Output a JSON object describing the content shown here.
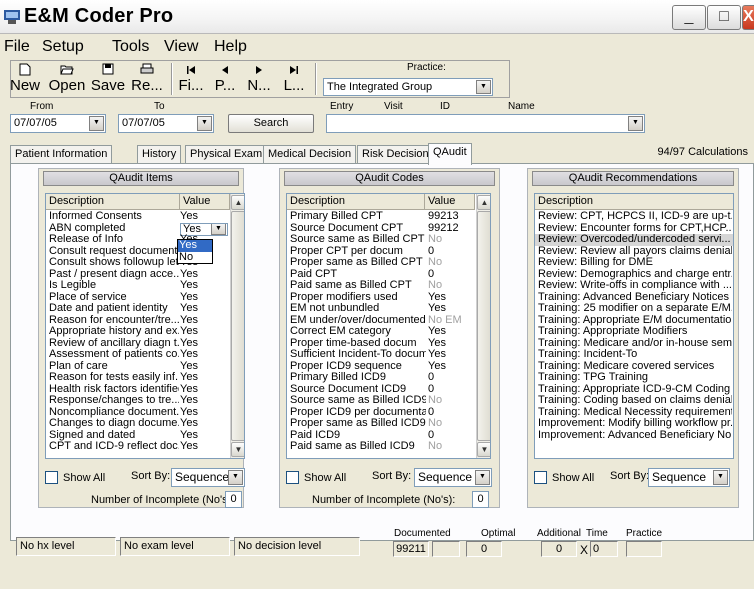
{
  "window": {
    "title": "E&M Coder Pro",
    "minimize_glyph": "_",
    "maximize_glyph": "□",
    "close_glyph": "X"
  },
  "menu": [
    "File",
    "Setup",
    "Tools",
    "View",
    "Help"
  ],
  "toolbar": {
    "buttons": [
      {
        "label": "New",
        "icon": "new-file-icon",
        "glyph": "🗋"
      },
      {
        "label": "Open",
        "icon": "open-folder-icon",
        "glyph": "📂"
      },
      {
        "label": "Save",
        "icon": "save-disk-icon",
        "glyph": "💾"
      },
      {
        "label": "Re...",
        "icon": "printer-icon",
        "glyph": "🖶"
      },
      {
        "label": "Fi...",
        "icon": "first-record-icon",
        "glyph": "|◂"
      },
      {
        "label": "P...",
        "icon": "previous-record-icon",
        "glyph": "◂"
      },
      {
        "label": "N...",
        "icon": "next-record-icon",
        "glyph": "▸"
      },
      {
        "label": "L...",
        "icon": "last-record-icon",
        "glyph": "▸|"
      }
    ],
    "practice_label": "Practice:",
    "practice_value": "The Integrated Group"
  },
  "filter": {
    "from_label": "From",
    "to_label": "To",
    "from_value": "07/07/05",
    "to_value": "07/07/05",
    "search_label": "Search",
    "entry_label": "Entry",
    "visit_label": "Visit",
    "id_label": "ID",
    "name_label": "Name",
    "entry_value": ""
  },
  "tabs": [
    "Patient Information",
    "History",
    "Physical Exam",
    "Medical Decision",
    "Risk Decision",
    "QAudit"
  ],
  "active_tab": "QAudit",
  "calculations_text": "94/97 Calculations",
  "qaudit_items": {
    "header": "QAudit Items",
    "col_description": "Description",
    "col_value": "Value",
    "rows": [
      {
        "d": "Informed Consents",
        "v": "Yes"
      },
      {
        "d": "ABN completed",
        "v": "Yes"
      },
      {
        "d": "Release of Info",
        "v": "Yes"
      },
      {
        "d": "Consult request document...",
        "v": "No"
      },
      {
        "d": "Consult shows followup let...",
        "v": "Yes"
      },
      {
        "d": "Past / present diagn acce...",
        "v": "Yes"
      },
      {
        "d": "Is Legible",
        "v": "Yes"
      },
      {
        "d": "Place of service",
        "v": "Yes"
      },
      {
        "d": "Date and patient identity",
        "v": "Yes"
      },
      {
        "d": "Reason for encounter/tre...",
        "v": "Yes"
      },
      {
        "d": "Appropriate history and ex...",
        "v": "Yes"
      },
      {
        "d": "Review of ancillary diagn t...",
        "v": "Yes"
      },
      {
        "d": "Assessment of patients co...",
        "v": "Yes"
      },
      {
        "d": "Plan of care",
        "v": "Yes"
      },
      {
        "d": "Reason for tests easily inf...",
        "v": "Yes"
      },
      {
        "d": "Health risk factors identified",
        "v": "Yes"
      },
      {
        "d": "Response/changes to tre...",
        "v": "Yes"
      },
      {
        "d": "Noncompliance document...",
        "v": "Yes"
      },
      {
        "d": "Changes to diagn docume...",
        "v": "Yes"
      },
      {
        "d": "Signed and dated",
        "v": "Yes"
      },
      {
        "d": "CPT and ICD-9 reflect doc...",
        "v": "Yes"
      }
    ],
    "dropdown_options": [
      "Yes",
      "No"
    ],
    "dropdown_selected": "Yes",
    "show_all_label": "Show All",
    "sort_by_label": "Sort By:",
    "sort_value": "Sequence",
    "incomplete_label": "Number of Incomplete (No's):",
    "incomplete_value": "0"
  },
  "qaudit_codes": {
    "header": "QAudit Codes",
    "col_description": "Description",
    "col_value": "Value",
    "rows": [
      {
        "d": "Primary Billed CPT",
        "v": "99213",
        "grey": false
      },
      {
        "d": "Source Document CPT",
        "v": "99212",
        "grey": false
      },
      {
        "d": "Source same as Billed CPT",
        "v": "No",
        "grey": true
      },
      {
        "d": "Proper CPT per docum",
        "v": "0",
        "grey": false
      },
      {
        "d": "Proper same as Billed CPT",
        "v": "No",
        "grey": true
      },
      {
        "d": "Paid CPT",
        "v": "0",
        "grey": false
      },
      {
        "d": "Paid same as Billed CPT",
        "v": "No",
        "grey": true
      },
      {
        "d": "Proper modifiers used",
        "v": "Yes",
        "grey": false
      },
      {
        "d": "EM not unbundled",
        "v": "Yes",
        "grey": false
      },
      {
        "d": "EM under/over/documented",
        "v": "No EM",
        "grey": true
      },
      {
        "d": "Correct EM category",
        "v": "Yes",
        "grey": false
      },
      {
        "d": "Proper time-based docum",
        "v": "Yes",
        "grey": false
      },
      {
        "d": "Sufficient Incident-To docum",
        "v": "Yes",
        "grey": false
      },
      {
        "d": "Proper ICD9 sequence",
        "v": "Yes",
        "grey": false
      },
      {
        "d": "Primary Billed ICD9",
        "v": "0",
        "grey": false
      },
      {
        "d": "Source Document ICD9",
        "v": "0",
        "grey": false
      },
      {
        "d": "Source same as Billed ICD9",
        "v": "No",
        "grey": true
      },
      {
        "d": "Proper ICD9 per documenta...",
        "v": "0",
        "grey": false
      },
      {
        "d": "Proper same as Billed ICD9",
        "v": "No",
        "grey": true
      },
      {
        "d": "Paid ICD9",
        "v": "0",
        "grey": false
      },
      {
        "d": "Paid same as Billed ICD9",
        "v": "No",
        "grey": true
      }
    ],
    "show_all_label": "Show All",
    "sort_by_label": "Sort By:",
    "sort_value": "Sequence",
    "incomplete_label": "Number of Incomplete (No's):",
    "incomplete_value": "0"
  },
  "qaudit_recs": {
    "header": "QAudit Recommendations",
    "col_description": "Description",
    "rows": [
      "Review: CPT, HCPCS II, ICD-9 are up-t...",
      "Review: Encounter forms for CPT,HCP...",
      "Review: Overcoded/undercoded servi...",
      "Review: Review all payors claims denials",
      "Review: Billing for DME",
      "Review: Demographics and charge entr...",
      "Review: Write-offs in compliance with ...",
      "Training: Advanced Beneficiary Notices",
      "Training: 25 modifier on a separate E/M...",
      "Training: Appropriate E/M documentation",
      "Training: Appropriate Modifiers",
      "Training: Medicare and/or in-house sem...",
      "Training: Incident-To",
      "Training: Medicare covered services",
      "Training: TPG Training",
      "Training: Appropriate ICD-9-CM Coding",
      "Training: Coding based on claims denial...",
      "Training: Medical Necessity requirements",
      "Improvement: Modify billing workflow pr...",
      "Improvement: Advanced Beneficiary No..."
    ],
    "selected_index": 2,
    "show_all_label": "Show All",
    "sort_by_label": "Sort By:",
    "sort_value": "Sequence"
  },
  "status": {
    "hx_level": "No hx level",
    "exam_level": "No exam level",
    "decision_level": "No decision level",
    "documented_label": "Documented",
    "documented_value": "99211",
    "optimal_label": "Optimal",
    "optimal_value": "0",
    "additional_label": "Additional",
    "additional_value": "0",
    "time_label": "Time",
    "time_value": "0",
    "times_glyph": "X",
    "practice_label": "Practice"
  }
}
